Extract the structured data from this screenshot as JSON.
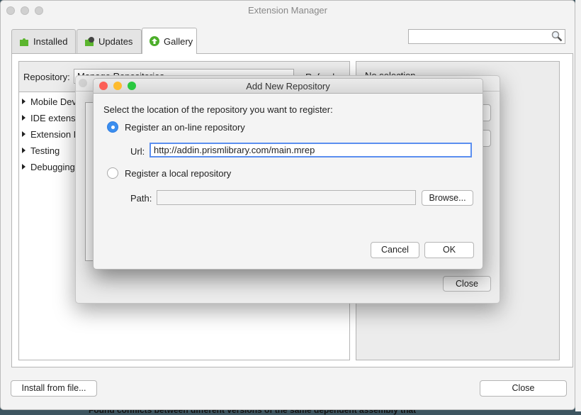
{
  "background_text": "Found conflicts between different versions of the same dependent assembly that",
  "window": {
    "title": "Extension Manager"
  },
  "tabs": [
    {
      "label": "Installed",
      "icon": "puzzle-icon"
    },
    {
      "label": "Updates",
      "icon": "puzzle-update-icon"
    },
    {
      "label": "Gallery",
      "icon": "green-up-arrow-icon",
      "active": true
    }
  ],
  "search": {
    "value": "",
    "placeholder": ""
  },
  "gallery": {
    "repository_label": "Repository:",
    "repository_value": "Manage Repositories...",
    "refresh_label": "Refresh",
    "categories": [
      "Mobile Development",
      "IDE extensions",
      "Extension Development",
      "Testing",
      "Debugging"
    ],
    "detail_text": "No selection"
  },
  "manage_dialog": {
    "close_label": "Close"
  },
  "add_dialog": {
    "title": "Add New Repository",
    "prompt": "Select the location of the repository you want to register:",
    "online_option": "Register an on-line repository",
    "url_label": "Url:",
    "url_value": "http://addin.prismlibrary.com/main.mrep",
    "local_option": "Register a local repository",
    "path_label": "Path:",
    "path_value": "",
    "browse_label": "Browse...",
    "cancel_label": "Cancel",
    "ok_label": "OK",
    "selected_option": "online"
  },
  "footer": {
    "install_label": "Install from file...",
    "close_label": "Close"
  }
}
